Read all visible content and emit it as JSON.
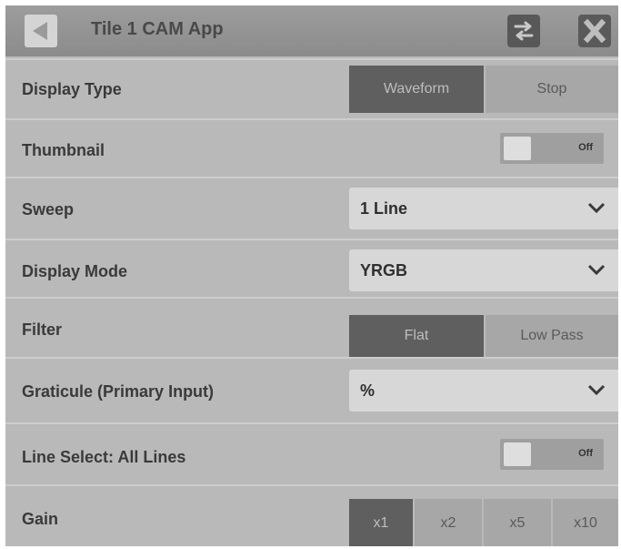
{
  "titlebar": {
    "title": "Tile 1 CAM App",
    "back_icon": "back-arrow-icon",
    "swap_icon": "swap-arrows-icon",
    "close_icon": "close-x-icon"
  },
  "rows": {
    "display_type": {
      "label": "Display Type",
      "options": [
        "Waveform",
        "Stop"
      ],
      "selected": "Waveform"
    },
    "thumbnail": {
      "label": "Thumbnail",
      "state": "Off"
    },
    "sweep": {
      "label": "Sweep",
      "value": "1 Line"
    },
    "display_mode": {
      "label": "Display Mode",
      "value": "YRGB"
    },
    "filter": {
      "label": "Filter",
      "options": [
        "Flat",
        "Low Pass"
      ],
      "selected": "Flat"
    },
    "graticule": {
      "label": "Graticule (Primary Input)",
      "value": "%"
    },
    "line_select": {
      "label": "Line Select: All Lines",
      "state": "Off"
    },
    "gain": {
      "label": "Gain",
      "options": [
        "x1",
        "x2",
        "x5",
        "x10"
      ],
      "selected": "x1"
    }
  },
  "colors": {
    "panel_bg": "#b9b9b9",
    "active_segment": "#5f5f5f",
    "inactive_segment": "#a7a7a7",
    "dropdown_bg": "#d7d7d7"
  }
}
